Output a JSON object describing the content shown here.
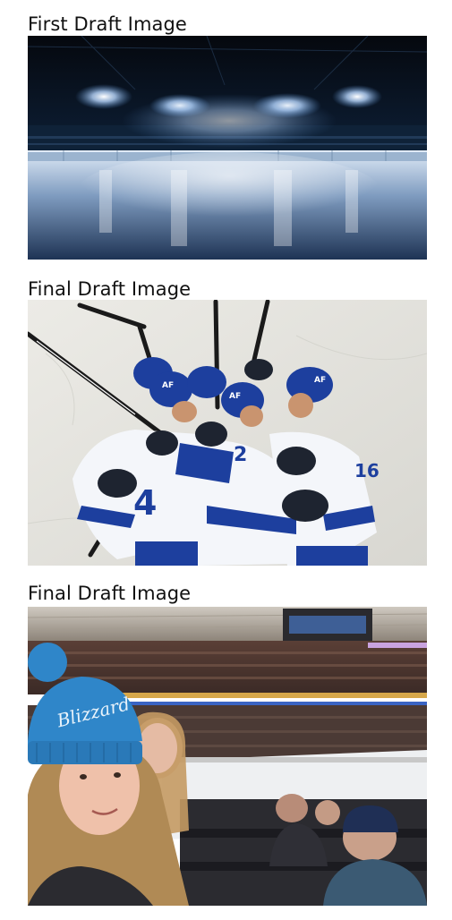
{
  "sections": [
    {
      "title": "First Draft Image",
      "image": "empty-ice-rink-arena-photo"
    },
    {
      "title": "Final Draft Image",
      "image": "hockey-team-celebration-huddle-photo"
    },
    {
      "title": "Final Draft Image",
      "image": "arena-crowd-selfie-photo"
    }
  ],
  "photo2": {
    "jersey_numbers": [
      "4",
      "2",
      "16"
    ],
    "helmet_logo": "AF"
  },
  "photo3": {
    "beanie_text": "Blizzard"
  },
  "colors": {
    "rink_night": "#0b1626",
    "ice_highlight": "#dfe9f5",
    "jersey_blue": "#1d3f9e",
    "jersey_white": "#f4f6fa",
    "beanie_blue": "#2f86c9"
  }
}
